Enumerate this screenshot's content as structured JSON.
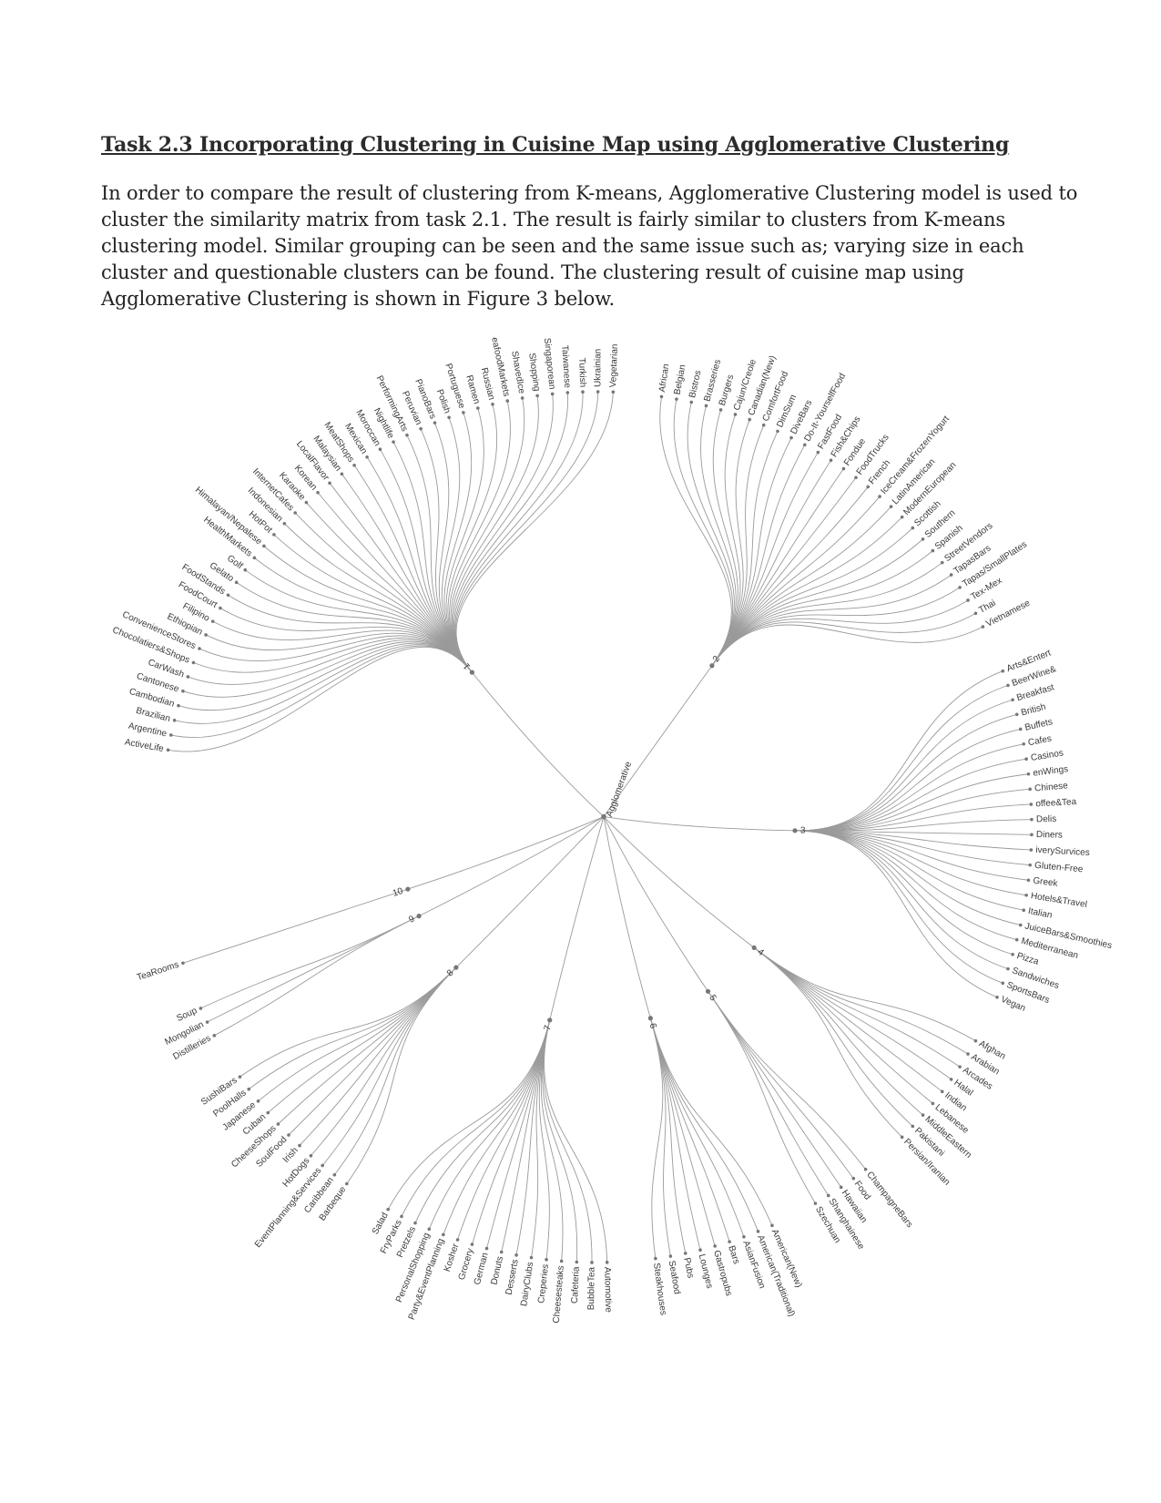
{
  "section": {
    "task_number": "Task 2.3",
    "title": "Incorporating Clustering in Cuisine Map using Agglomerative Clustering"
  },
  "paragraph": "In order to compare the result of clustering from K-means, Agglomerative Clustering model is used to cluster the similarity matrix from task 2.1. The result is fairly similar to clusters from K-means clustering model. Similar grouping can be seen and the same issue such as; varying size in each cluster and questionable clusters can be found. The clustering result of cuisine map using Agglomerative Clustering is shown in Figure 3 below.",
  "chart_data": {
    "type": "dendrogram",
    "layout": "radial",
    "root": "Agglomerative",
    "clusters": [
      {
        "name": "1",
        "leaves": [
          "ActiveLife",
          "Argentine",
          "Brazilian",
          "Cambodian",
          "Cantonese",
          "CarWash",
          "Chocolatiers&Shops",
          "ConvenienceStores",
          "Ethiopian",
          "Filipino",
          "FoodCourt",
          "FoodStands",
          "Gelato",
          "Golf",
          "HealthMarkets",
          "Himalayan/Nepalese",
          "HotPot",
          "Indonesian",
          "InternetCafes",
          "Karaoke",
          "Korean",
          "LocalFlavor",
          "Malaysian",
          "MeatShops",
          "Mexican",
          "Moroccan",
          "Nightlife",
          "PerformingArts",
          "Peruvian",
          "PianoBars",
          "Polish",
          "Portuguese",
          "Ramen",
          "Russian",
          "SeafoodMarkets",
          "ShavedIce",
          "Shopping",
          "Singaporean",
          "Taiwanese",
          "Turkish",
          "Ukrainian",
          "Vegetarian"
        ]
      },
      {
        "name": "2",
        "leaves": [
          "African",
          "Belgian",
          "Bistros",
          "Brasseries",
          "Burgers",
          "Cajun/Creole",
          "Canadian(New)",
          "ComfortFood",
          "DimSum",
          "DiveBars",
          "Do-It-YourselfFood",
          "FastFood",
          "Fish&Chips",
          "Fondue",
          "FoodTrucks",
          "French",
          "IceCream&FrozenYogurt",
          "LatinAmerican",
          "ModernEuropean",
          "Scottish",
          "Southern",
          "Spanish",
          "StreetVendors",
          "TapasBars",
          "Tapas/SmallPlates",
          "Tex-Mex",
          "Thai",
          "Vietnamese"
        ]
      },
      {
        "name": "3",
        "leaves": [
          "Arts&Entert",
          "BeerWine&",
          "Breakfast",
          "British",
          "Buffets",
          "Cafes",
          "Casinos",
          "enWings",
          "Chinese",
          "offee&Tea",
          "Delis",
          "Diners",
          "iverySurvices",
          "Gluten-Free",
          "Greek",
          "Hotels&Travel",
          "Italian",
          "JuiceBars&Smoothies",
          "Mediterranean",
          "Pizza",
          "Sandwiches",
          "SportsBars",
          "Vegan"
        ]
      },
      {
        "name": "4",
        "leaves": [
          "Afghan",
          "Arabian",
          "Arcades",
          "Halal",
          "Indian",
          "Lebanese",
          "MiddleEastern",
          "Pakistani",
          "Persian/Iranian"
        ]
      },
      {
        "name": "5",
        "leaves": [
          "ChampagneBars",
          "Food",
          "Hawaiian",
          "Shanghainese",
          "Szechuan"
        ]
      },
      {
        "name": "6",
        "leaves": [
          "American(New)",
          "American(Traditional)",
          "AsianFusion",
          "Bars",
          "Gastropubs",
          "Lounges",
          "Pubs",
          "Seafood",
          "Steakhouses"
        ]
      },
      {
        "name": "7",
        "leaves": [
          "Automotive",
          "BubbleTea",
          "Cafeteria",
          "Cheesesteaks",
          "Creperies",
          "DairyClubs",
          "Desserts",
          "Donuts",
          "German",
          "Grocery",
          "Kosher",
          "Party&EventPlanning",
          "PersonalShopping",
          "Pretzels",
          "FryParks",
          "Salad"
        ]
      },
      {
        "name": "8",
        "leaves": [
          "Barbeque",
          "Caribbean",
          "EventPlanning&Services",
          "HotDogs",
          "Irish",
          "SoulFood",
          "CheeseShops",
          "Cuban",
          "Japanese",
          "PoolHalls",
          "SushiBars"
        ]
      },
      {
        "name": "9",
        "leaves": [
          "Distilleries",
          "Mongolian",
          "Soup"
        ]
      },
      {
        "name": "10",
        "leaves": [
          "TeaRooms"
        ]
      }
    ]
  }
}
